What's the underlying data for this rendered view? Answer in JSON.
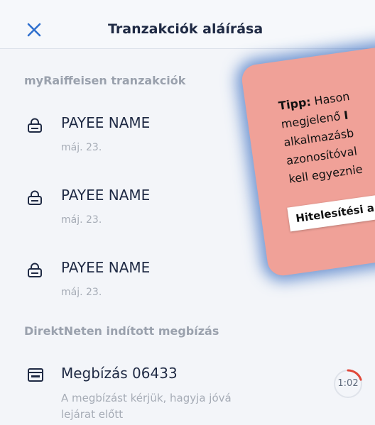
{
  "header": {
    "title": "Tranzakciók aláírása",
    "close_icon": "close-icon"
  },
  "sections": {
    "myraiffeisen": {
      "title": "myRaiffeisen tranzakciók",
      "items": [
        {
          "name": "PAYEE NAME",
          "date": "máj. 23.",
          "icon": "lock-icon"
        },
        {
          "name": "PAYEE NAME",
          "date": "máj. 23.",
          "icon": "lock-icon"
        },
        {
          "name": "PAYEE NAME",
          "date": "máj. 23.",
          "icon": "lock-icon"
        }
      ]
    },
    "direktnet": {
      "title": "DirektNeten indított megbízás",
      "item": {
        "name": "Megbízás  06433",
        "description_line1": "A megbízást kérjük, hagyja jóvá",
        "description_line2": "lejárat előtt",
        "timer": "1:02",
        "timer_progress": 0.2,
        "icon": "card-terminal-icon"
      }
    }
  },
  "tip": {
    "label": "Tipp:",
    "line1_rest": " Hason",
    "line2": "megjelenő ",
    "line2_bold": "I",
    "line3": "alkalmazásb",
    "line4": "azonosítóval",
    "line5": "kell egyeznie",
    "tag": "Hitelesítési a"
  },
  "colors": {
    "accent": "#2f6fce",
    "tip_background": "#f0a198",
    "tip_glow": "#4476c4",
    "timer_red": "#e0483a"
  }
}
